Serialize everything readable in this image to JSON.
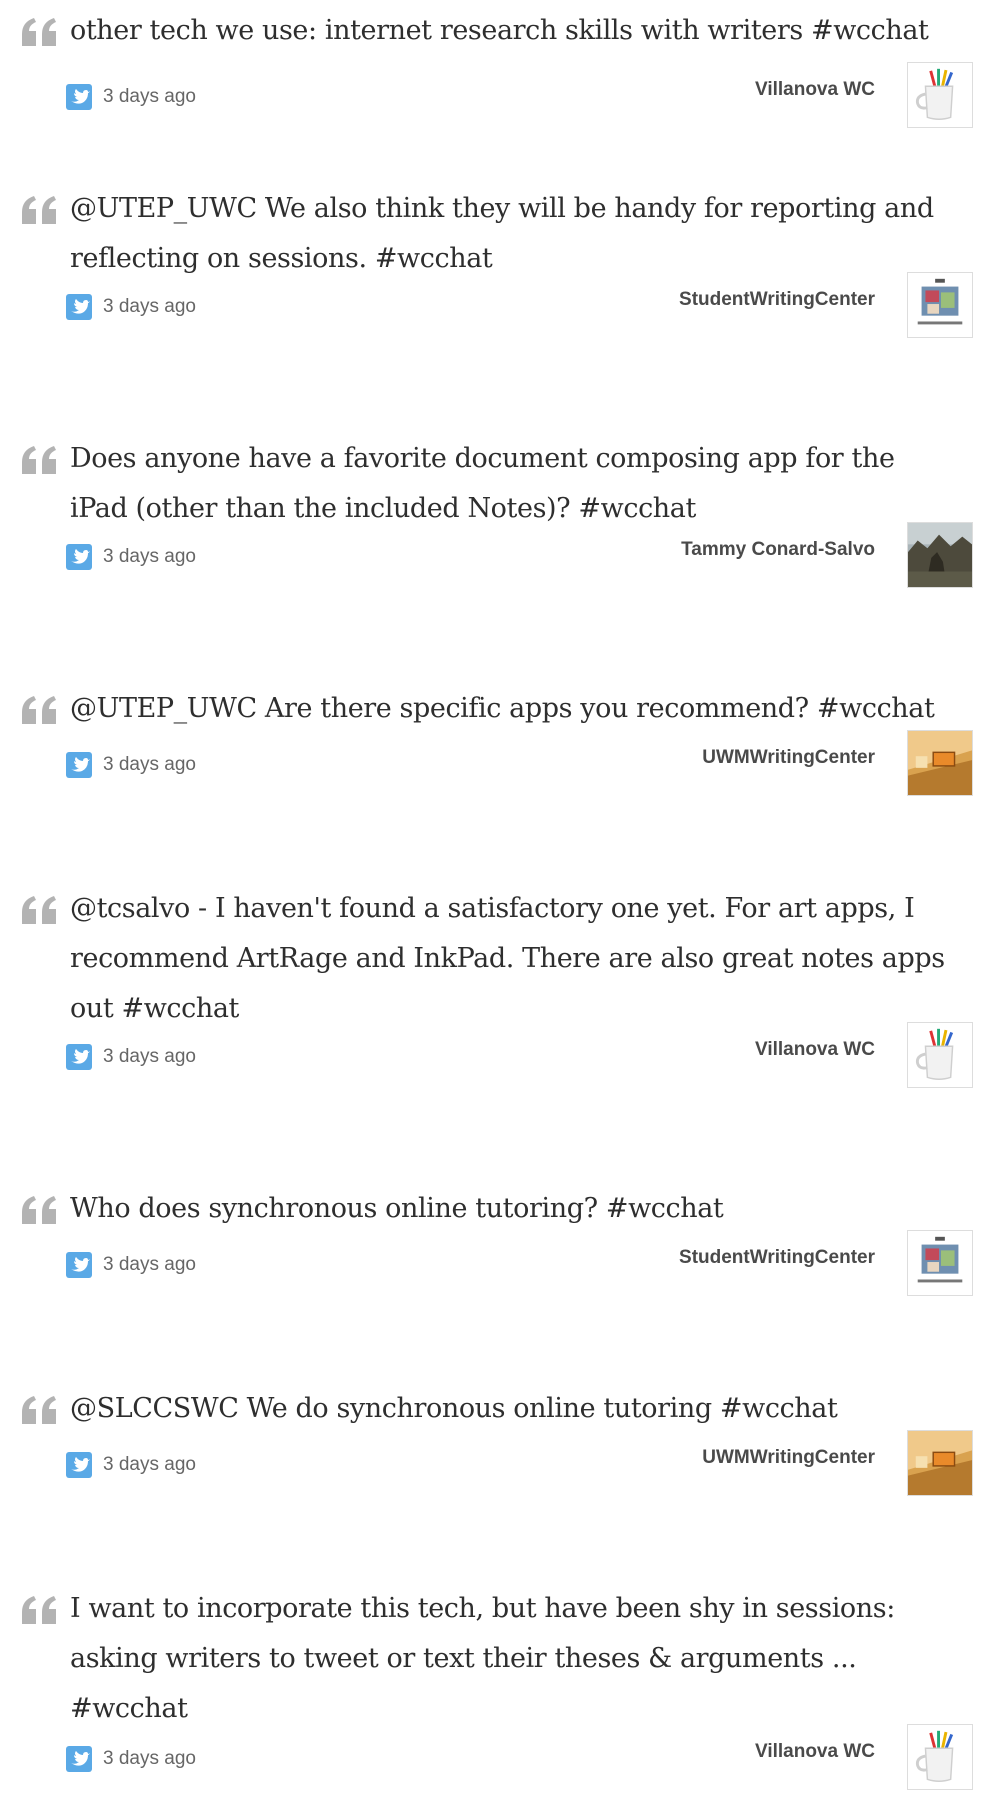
{
  "tweets": [
    {
      "text_lines": [
        "other tech we use: internet research skills with writers #wcchat"
      ],
      "time": "3 days ago",
      "author": "Villanova WC",
      "avatar": "mug-pencils-avatar"
    },
    {
      "text_lines": [
        "@UTEP_UWC We also think they will be handy for reporting and",
        "reflecting on sessions. #wcchat"
      ],
      "time": "3 days ago",
      "author": "StudentWritingCenter",
      "avatar": "student-writing-center-avatar"
    },
    {
      "text_lines": [
        "Does anyone have a favorite document composing app for the",
        "iPad (other than the included Notes)? #wcchat"
      ],
      "time": "3 days ago",
      "author": "Tammy Conard-Salvo",
      "avatar": "outdoor-photo-avatar"
    },
    {
      "text_lines": [
        "@UTEP_UWC Are there specific apps you recommend? #wcchat"
      ],
      "time": "3 days ago",
      "author": "UWMWritingCenter",
      "avatar": "hallway-photo-avatar"
    },
    {
      "text_lines": [
        "@tcsalvo - I haven't found a satisfactory one yet. For art apps, I",
        "recommend ArtRage and InkPad. There are also great notes apps",
        "out #wcchat"
      ],
      "time": "3 days ago",
      "author": "Villanova WC",
      "avatar": "mug-pencils-avatar"
    },
    {
      "text_lines": [
        "Who does synchronous online tutoring? #wcchat"
      ],
      "time": "3 days ago",
      "author": "StudentWritingCenter",
      "avatar": "student-writing-center-avatar"
    },
    {
      "text_lines": [
        "@SLCCSWC We do synchronous online tutoring #wcchat"
      ],
      "time": "3 days ago",
      "author": "UWMWritingCenter",
      "avatar": "hallway-photo-avatar"
    },
    {
      "text_lines": [
        "I want to incorporate this tech, but have been shy in sessions:",
        "asking writers to tweet or text their theses & arguments ...",
        "#wcchat"
      ],
      "time": "3 days ago",
      "author": "Villanova WC",
      "avatar": "mug-pencils-avatar"
    }
  ],
  "icons": {
    "quote": "quote-mark-icon",
    "bird": "twitter-bird-icon"
  },
  "colors": {
    "quote_mark": "#b3b3b3",
    "twitter_blue": "#5aa9e6",
    "text": "#2e2e2e",
    "meta": "#666666",
    "author": "#4a4a4a"
  }
}
